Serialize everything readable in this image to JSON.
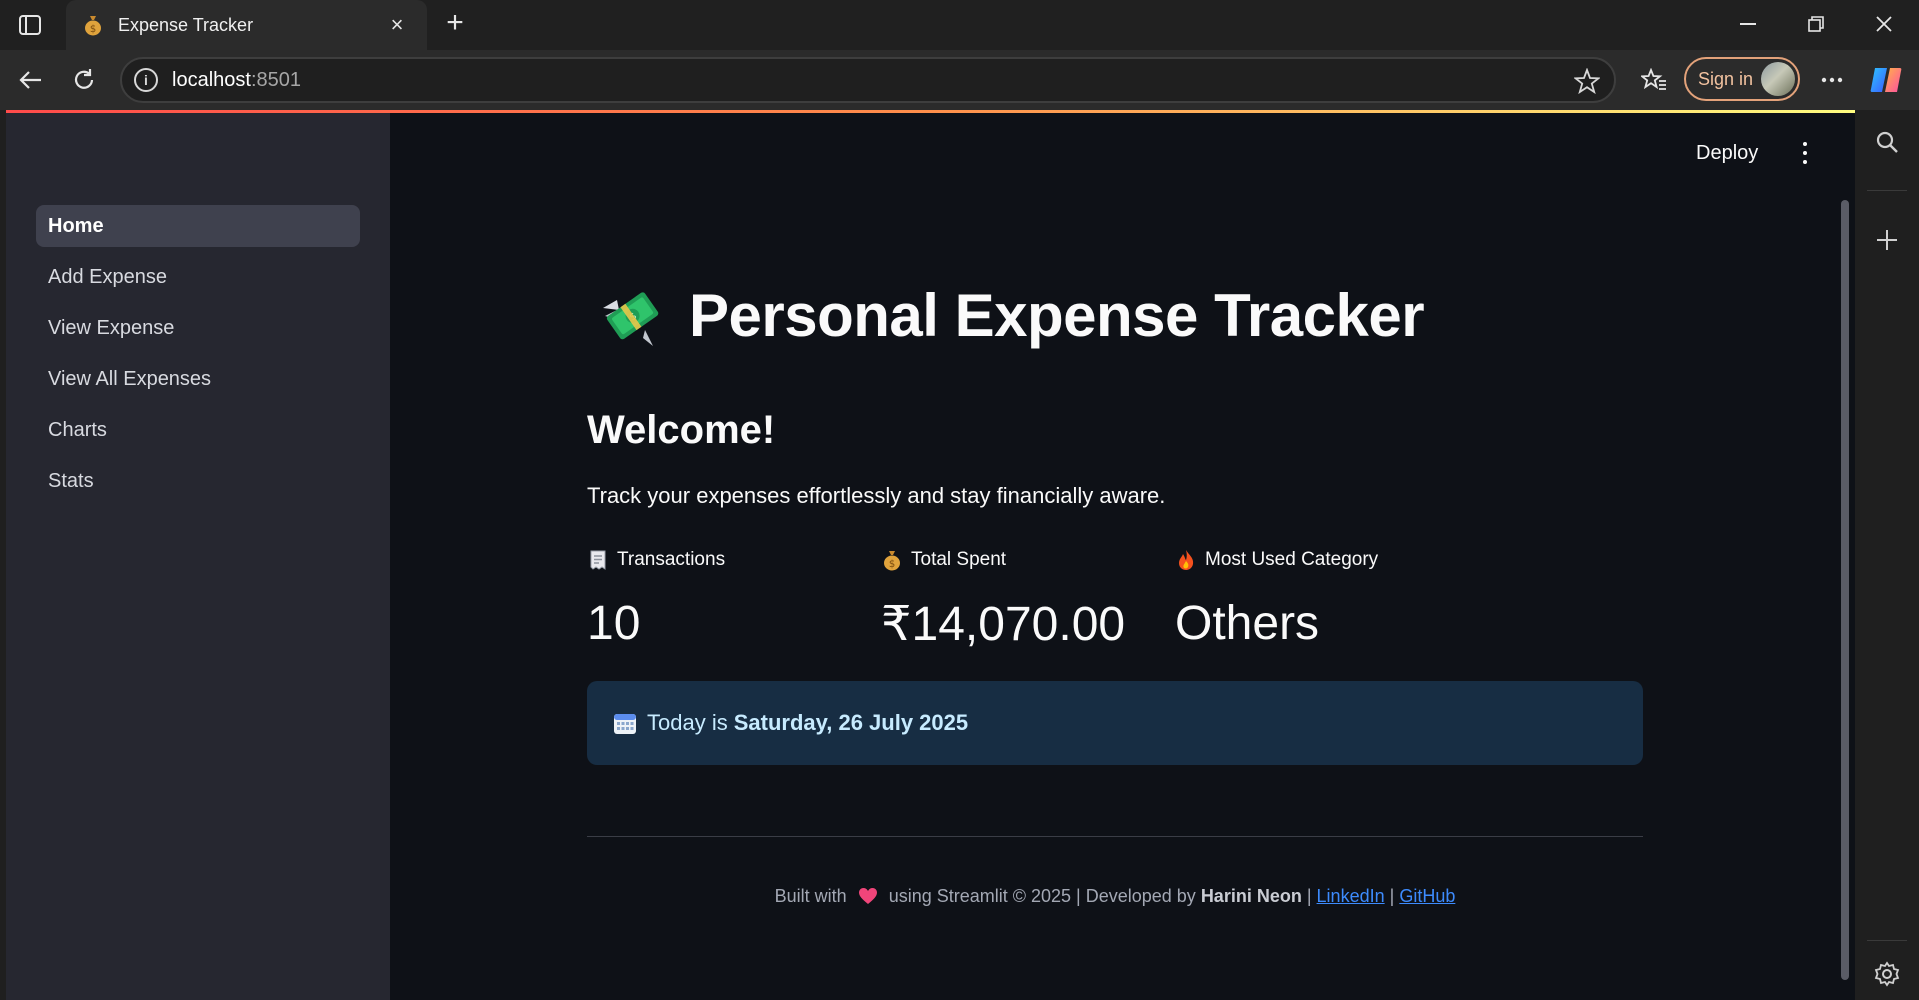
{
  "browser": {
    "tab_title": "Expense Tracker",
    "url_host": "localhost",
    "url_port": ":8501",
    "sign_in_label": "Sign in"
  },
  "app": {
    "toolbar": {
      "deploy_label": "Deploy"
    },
    "sidebar": {
      "items": [
        {
          "label": "Home",
          "active": true
        },
        {
          "label": "Add Expense"
        },
        {
          "label": "View Expense"
        },
        {
          "label": "View All Expenses"
        },
        {
          "label": "Charts"
        },
        {
          "label": "Stats"
        }
      ]
    },
    "title": "Personal Expense Tracker",
    "welcome_heading": "Welcome!",
    "tagline": "Track your expenses effortlessly and stay financially aware.",
    "metrics": [
      {
        "label": "Transactions",
        "value": "10",
        "icon": "receipt-icon"
      },
      {
        "label": "Total Spent",
        "value": "₹14,070.00",
        "icon": "money-bag-icon"
      },
      {
        "label": "Most Used Category",
        "value": "Others",
        "icon": "fire-icon"
      }
    ],
    "info": {
      "prefix": "Today is",
      "date": "Saturday, 26 July 2025"
    },
    "footer": {
      "built_with": "Built with",
      "using": "using Streamlit © 2025 | Developed by",
      "developer": "Harini Neon",
      "sep1": "|",
      "sep2": "|",
      "linkedin": "LinkedIn",
      "github": "GitHub"
    }
  },
  "colors": {
    "page_bg": "#0e1117",
    "sidebar_bg": "#262730",
    "info_bg": "#172d43",
    "link": "#3d8bfd",
    "accent_gradient": [
      "#ff4b4b",
      "#fffd80"
    ]
  }
}
